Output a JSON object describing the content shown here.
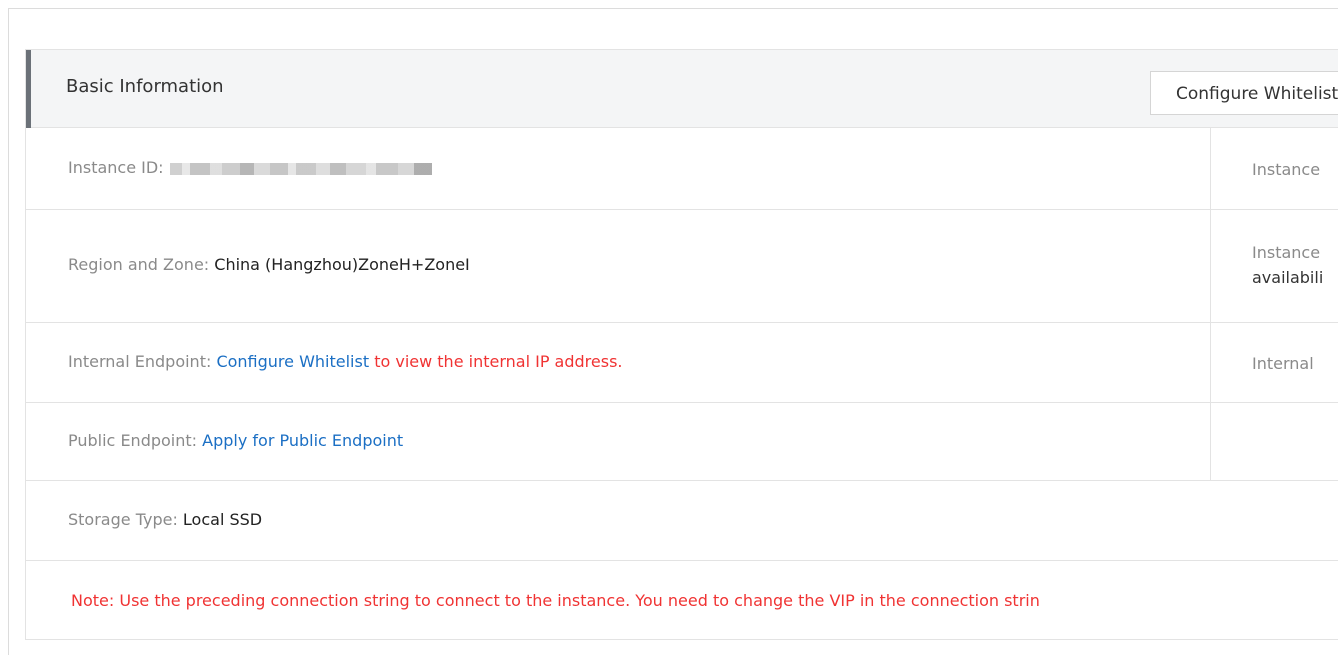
{
  "panel": {
    "title": "Basic Information",
    "header_button": "Configure Whitelist"
  },
  "rows": {
    "instance_id": {
      "label": "Instance ID:",
      "value_redacted": true,
      "right_text": "Instance"
    },
    "region": {
      "label": "Region and Zone:",
      "value": "China (Hangzhou)ZoneH+ZoneI",
      "right_line1": "Instance",
      "right_line2": "availabili"
    },
    "internal_endpoint": {
      "label": "Internal Endpoint:",
      "link": "Configure Whitelist",
      "suffix": " to view the internal IP address.",
      "right_text": "Internal"
    },
    "public_endpoint": {
      "label": "Public Endpoint:",
      "link": "Apply for Public Endpoint"
    },
    "storage": {
      "label": "Storage Type:",
      "value": "Local SSD"
    },
    "note": {
      "text": "Note: Use the preceding connection string to connect to the instance. You need to change the VIP in the connection strin"
    }
  },
  "colors": {
    "link": "#1b6fc4",
    "warning": "#f03333",
    "label": "#8a8a8a",
    "header_bg": "#f4f5f6",
    "accent_bar": "#6b7178"
  }
}
